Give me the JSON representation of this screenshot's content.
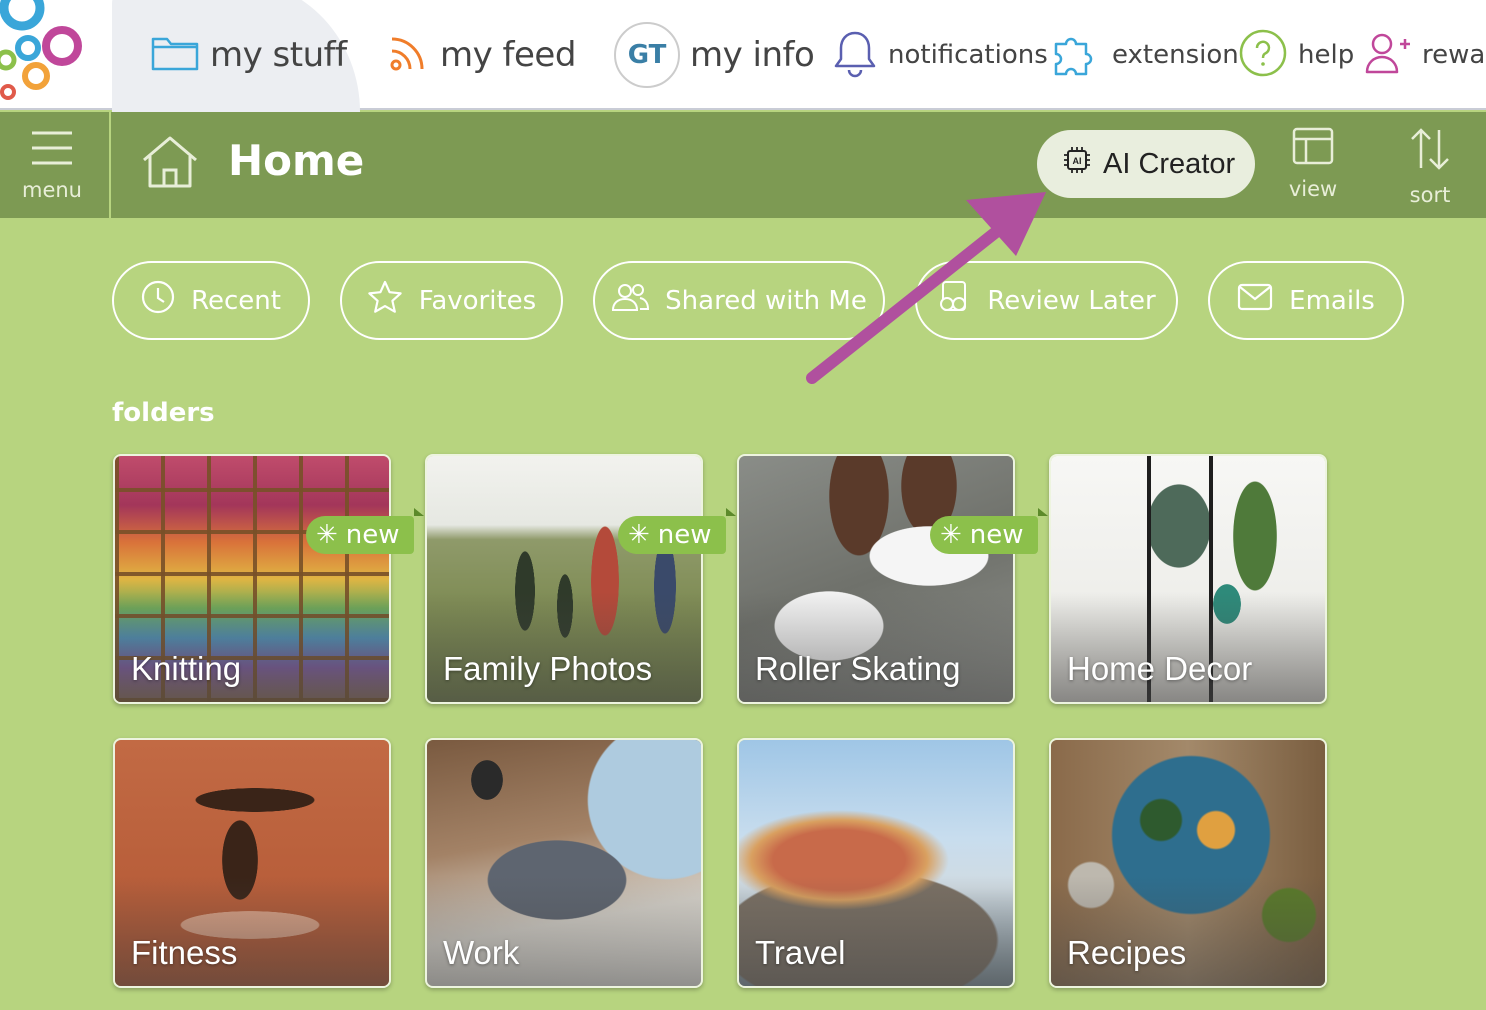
{
  "topnav": {
    "items": [
      {
        "label": "my stuff",
        "icon": "folder-icon",
        "active": true
      },
      {
        "label": "my feed",
        "icon": "rss-icon"
      },
      {
        "label": "my info",
        "avatar_initials": "GT"
      },
      {
        "label": "notifications",
        "icon": "bell-icon"
      },
      {
        "label": "extension",
        "icon": "puzzle-icon"
      },
      {
        "label": "help",
        "icon": "question-icon"
      },
      {
        "label": "rewar",
        "icon": "add-user-icon"
      }
    ]
  },
  "header": {
    "menu_label": "menu",
    "title": "Home",
    "ai_button": "AI Creator",
    "view_label": "view",
    "sort_label": "sort"
  },
  "filters": [
    {
      "label": "Recent",
      "icon": "clock-icon"
    },
    {
      "label": "Favorites",
      "icon": "star-icon"
    },
    {
      "label": "Shared with Me",
      "icon": "people-icon"
    },
    {
      "label": "Review Later",
      "icon": "review-icon"
    },
    {
      "label": "Emails",
      "icon": "mail-icon"
    }
  ],
  "folders_label": "folders",
  "folders": [
    {
      "name": "Knitting",
      "badge": "new"
    },
    {
      "name": "Family Photos",
      "badge": "new"
    },
    {
      "name": "Roller Skating",
      "badge": "new"
    },
    {
      "name": "Home Decor"
    },
    {
      "name": "Fitness"
    },
    {
      "name": "Work"
    },
    {
      "name": "Travel"
    },
    {
      "name": "Recipes"
    }
  ],
  "colors": {
    "header_bg": "#7d9a53",
    "page_bg": "#b7d47f",
    "badge_bg": "#8cc04b",
    "annotation_arrow": "#b0509e"
  }
}
